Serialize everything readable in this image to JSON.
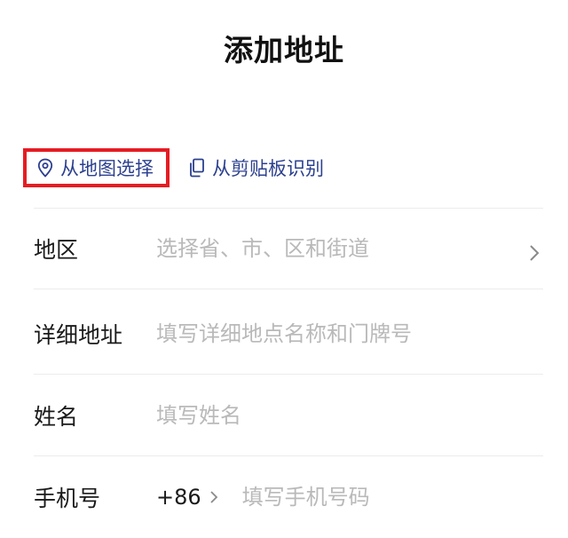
{
  "header": {
    "title": "添加地址"
  },
  "quick_actions": {
    "map_select": {
      "label": "从地图选择",
      "icon": "location-pin-icon",
      "highlight_color": "#e51c23"
    },
    "clipboard_recognize": {
      "label": "从剪贴板识别",
      "icon": "copy-icon"
    }
  },
  "form": {
    "region": {
      "label": "地区",
      "placeholder": "选择省、市、区和街道",
      "value": ""
    },
    "detail_address": {
      "label": "详细地址",
      "placeholder": "填写详细地点名称和门牌号",
      "value": ""
    },
    "name": {
      "label": "姓名",
      "placeholder": "填写姓名",
      "value": ""
    },
    "phone": {
      "label": "手机号",
      "country_code": "+86",
      "placeholder": "填写手机号码",
      "value": ""
    }
  },
  "colors": {
    "accent": "#2b3f8f",
    "placeholder": "#b9b9b9",
    "divider": "#ececec"
  }
}
